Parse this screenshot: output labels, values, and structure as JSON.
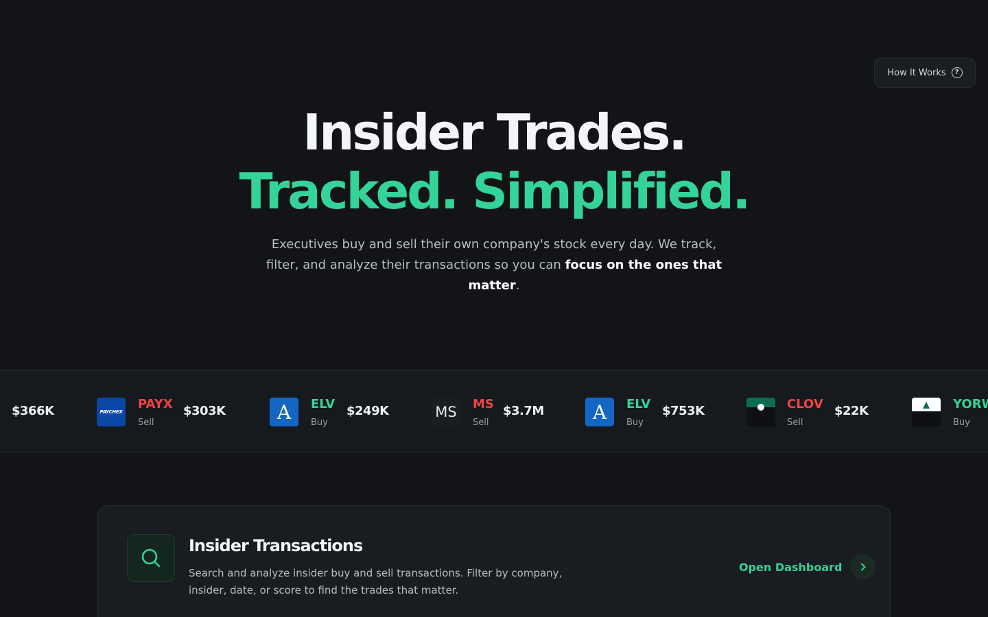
{
  "header": {
    "how_it_works_label": "How It Works",
    "how_it_works_icon": "question-circle-icon"
  },
  "hero": {
    "title_line1": "Insider Trades.",
    "title_line2": "Tracked. Simplified.",
    "subtitle_part1": "Executives buy and sell their own company's stock every day. We track, filter, and analyze their transactions so you can ",
    "subtitle_strong": "focus on the ones that matter",
    "subtitle_end": "."
  },
  "colors": {
    "accent_green": "#34d399",
    "sell_red": "#ef4444",
    "background": "#121418"
  },
  "ticker": {
    "leading_amount": "$366K",
    "items": [
      {
        "symbol": "PAYX",
        "side": "Sell",
        "amount": "$303K",
        "logo_text": "PAYCHEX"
      },
      {
        "symbol": "ELV",
        "side": "Buy",
        "amount": "$249K",
        "logo_text": "A"
      },
      {
        "symbol": "MS",
        "side": "Sell",
        "amount": "$3.7M",
        "logo_text": "MS"
      },
      {
        "symbol": "ELV",
        "side": "Buy",
        "amount": "$753K",
        "logo_text": "A"
      },
      {
        "symbol": "CLOV",
        "side": "Sell",
        "amount": "$22K"
      },
      {
        "symbol": "YORW",
        "side": "Buy"
      }
    ]
  },
  "card": {
    "title": "Insider Transactions",
    "description": "Search and analyze insider buy and sell transactions. Filter by company, insider, date, or score to find the trades that matter.",
    "link_label": "Open Dashboard",
    "icon": "search-icon",
    "arrow_icon": "chevron-right-icon"
  }
}
